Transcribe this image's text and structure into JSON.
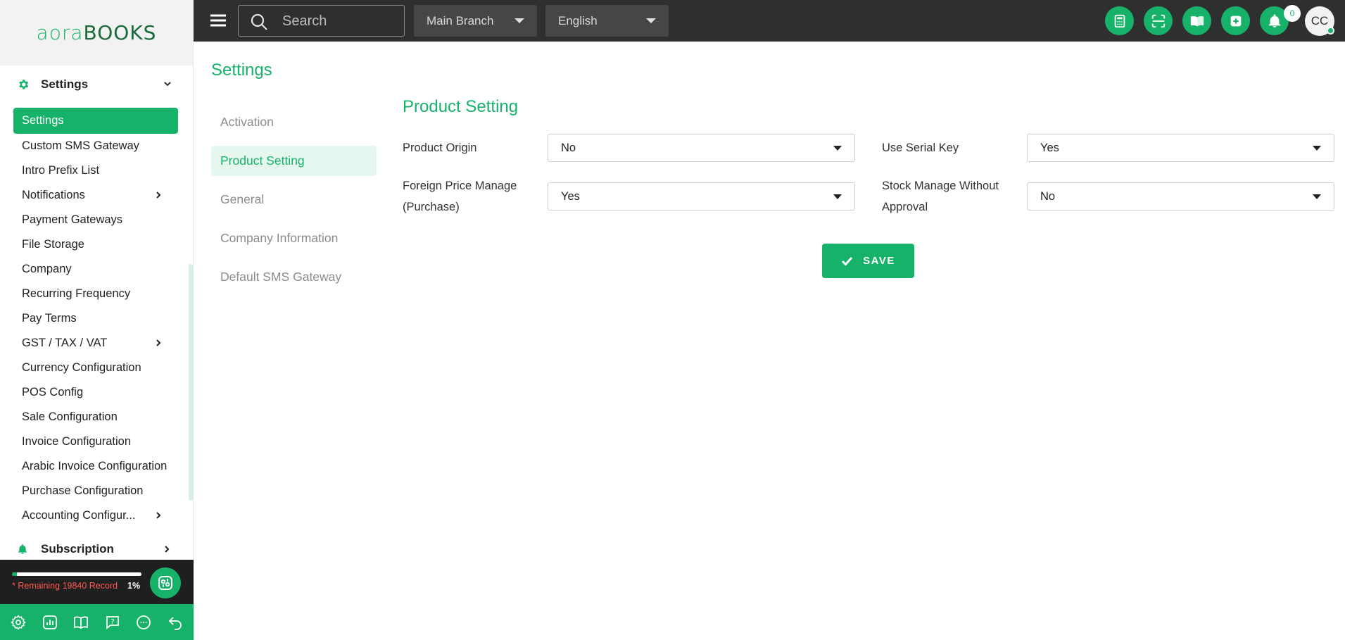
{
  "brand": {
    "logo_part1": "aora",
    "logo_part2": "BOOKS",
    "accent": "#17b26a",
    "dark": "#2f2f2f"
  },
  "sidebar": {
    "section_title": "Settings",
    "items": [
      {
        "label": "Settings",
        "active": true,
        "has_arrow": false
      },
      {
        "label": "Custom SMS Gateway",
        "has_arrow": false
      },
      {
        "label": "Intro Prefix List",
        "has_arrow": false
      },
      {
        "label": "Notifications",
        "has_arrow": true
      },
      {
        "label": "Payment Gateways",
        "has_arrow": false
      },
      {
        "label": "File Storage",
        "has_arrow": false
      },
      {
        "label": "Company",
        "has_arrow": false
      },
      {
        "label": "Recurring Frequency",
        "has_arrow": false
      },
      {
        "label": "Pay Terms",
        "has_arrow": false
      },
      {
        "label": "GST / TAX / VAT",
        "has_arrow": true
      },
      {
        "label": "Currency Configuration",
        "has_arrow": false
      },
      {
        "label": "POS Config",
        "has_arrow": false
      },
      {
        "label": "Sale Configuration",
        "has_arrow": false
      },
      {
        "label": "Invoice Configuration",
        "has_arrow": false
      },
      {
        "label": "Arabic Invoice Configuration",
        "has_arrow": false
      },
      {
        "label": "Purchase Configuration",
        "has_arrow": false
      },
      {
        "label": "Accounting Configur...",
        "has_arrow": true
      }
    ],
    "next_section": "Subscription",
    "usage": {
      "text": "* Remaining 19840 Record",
      "percent_label": "1%",
      "progress": 0.01
    },
    "bottom_icons": [
      "settings-icon",
      "report-icon",
      "book-icon",
      "help-icon",
      "chat-icon",
      "back-icon"
    ]
  },
  "topbar": {
    "search_placeholder": "Search",
    "branch": "Main Branch",
    "language": "English",
    "notification_count": "0",
    "avatar_initials": "CC",
    "icons": [
      "calculator-icon",
      "scan-icon",
      "book-icon",
      "add-icon",
      "bell-icon"
    ]
  },
  "content": {
    "page_title": "Settings",
    "subnav": [
      {
        "label": "Activation",
        "active": false
      },
      {
        "label": "Product Setting",
        "active": true
      },
      {
        "label": "General",
        "active": false
      },
      {
        "label": "Company Information",
        "active": false
      },
      {
        "label": "Default SMS Gateway",
        "active": false
      }
    ],
    "form": {
      "title": "Product Setting",
      "product_origin_label": "Product Origin",
      "product_origin_value": "No",
      "use_serial_key_label": "Use Serial Key",
      "use_serial_key_value": "Yes",
      "foreign_price_label_line1": "Foreign Price Manage",
      "foreign_price_label_line2": "(Purchase)",
      "foreign_price_value": "Yes",
      "stock_manage_label_line1": "Stock Manage Without",
      "stock_manage_label_line2": "Approval",
      "stock_manage_value": "No",
      "save_label": "SAVE"
    }
  }
}
